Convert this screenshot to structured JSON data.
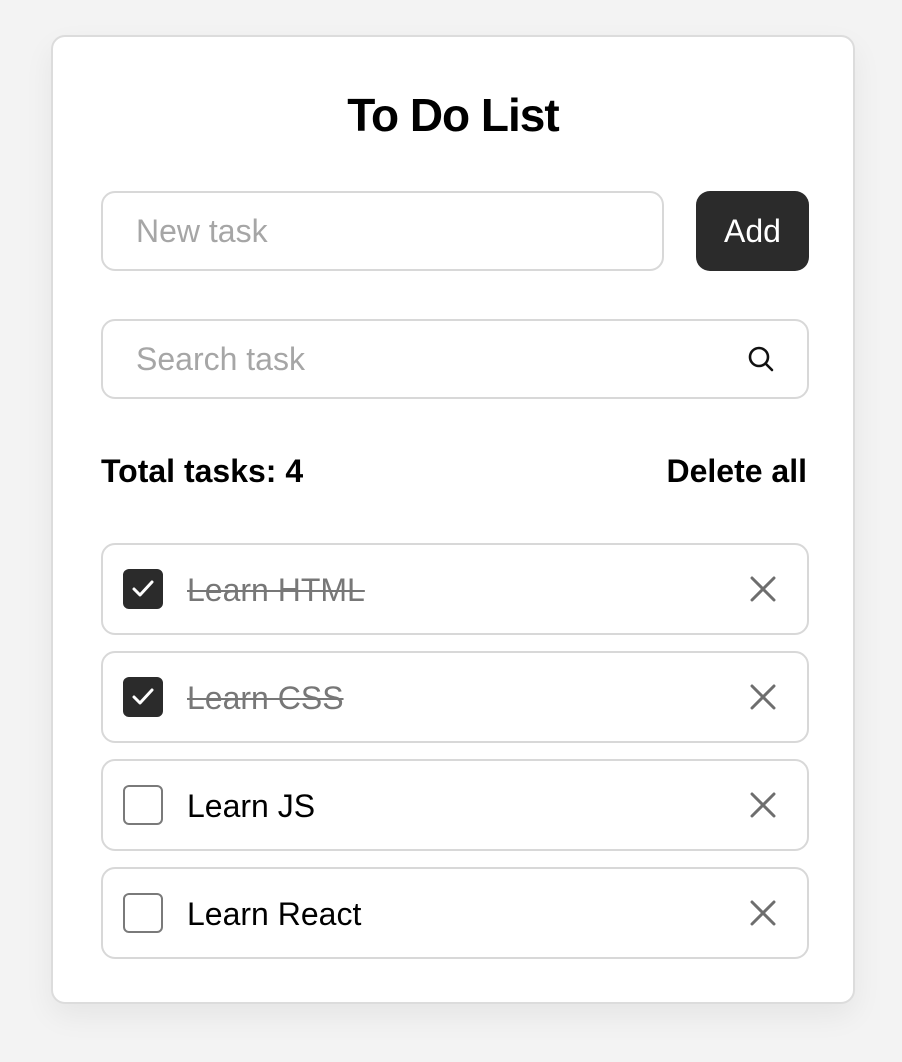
{
  "app": {
    "title": "To Do List"
  },
  "new_task": {
    "placeholder": "New task",
    "add_label": "Add"
  },
  "search": {
    "placeholder": "Search task",
    "icon": "search-icon"
  },
  "summary": {
    "total_label": "Total tasks: 4",
    "delete_all_label": "Delete all"
  },
  "tasks": [
    {
      "label": "Learn HTML",
      "done": true
    },
    {
      "label": "Learn CSS",
      "done": true
    },
    {
      "label": "Learn JS",
      "done": false
    },
    {
      "label": "Learn React",
      "done": false
    }
  ],
  "colors": {
    "accent": "#2b2b2b",
    "border": "#d8d8d8",
    "done_text": "#777777",
    "background": "#f3f3f3"
  }
}
